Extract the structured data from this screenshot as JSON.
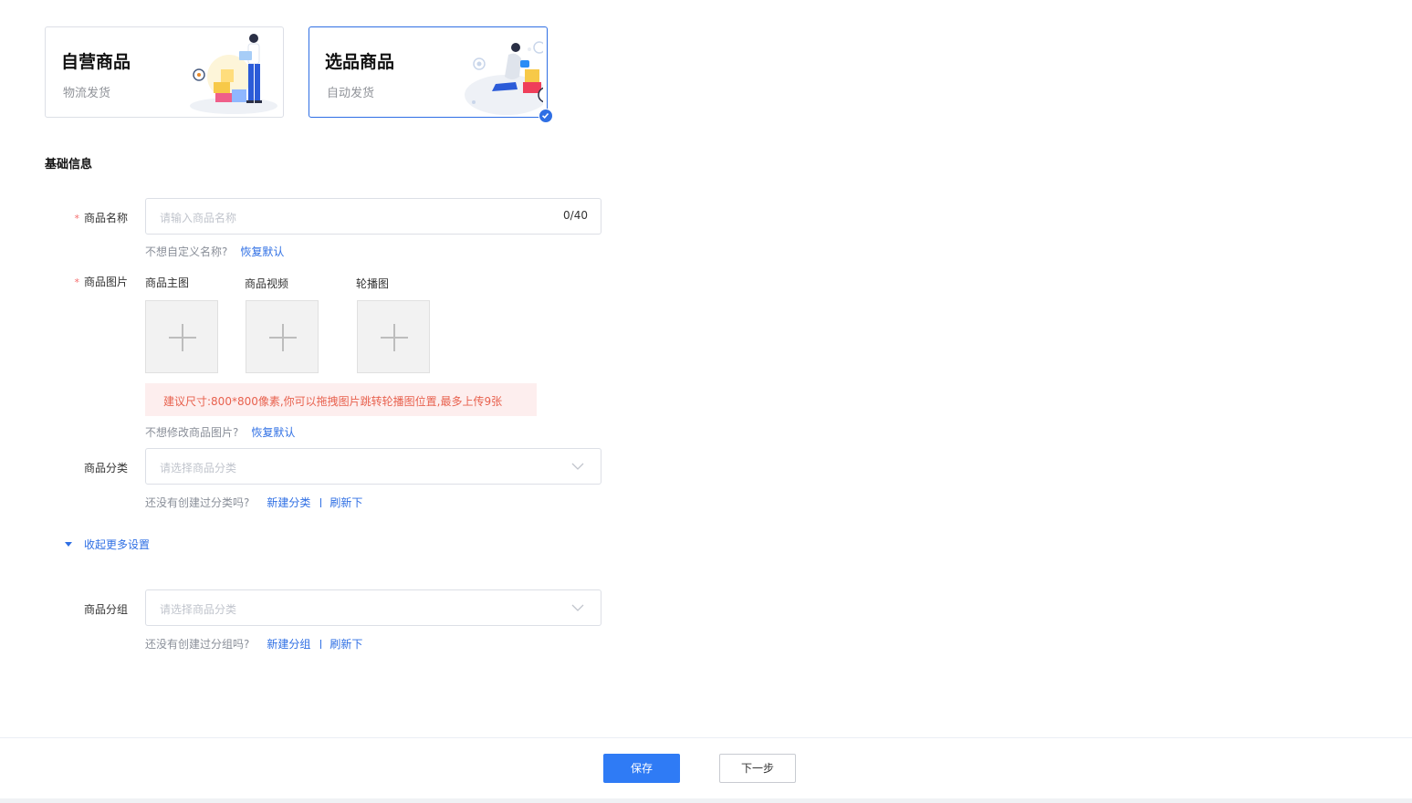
{
  "type_cards": [
    {
      "title": "自营商品",
      "subtitle": "物流发货",
      "selected": false
    },
    {
      "title": "选品商品",
      "subtitle": "自动发货",
      "selected": true
    }
  ],
  "section_title": "基础信息",
  "name_field": {
    "required_mark": "*",
    "label": "商品名称",
    "placeholder": "请输入商品名称",
    "counter": "0/40",
    "hint": "不想自定义名称?",
    "hint_link": "恢复默认"
  },
  "images_field": {
    "required_mark": "*",
    "label": "商品图片",
    "uploads": [
      {
        "label": "商品主图"
      },
      {
        "label": "商品视频"
      },
      {
        "label": "轮播图"
      }
    ],
    "warning": "建议尺寸:800*800像素,你可以拖拽图片跳转轮播图位置,最多上传9张",
    "hint": "不想修改商品图片?",
    "hint_link": "恢复默认"
  },
  "category_field": {
    "label": "商品分类",
    "placeholder": "请选择商品分类",
    "hint": "还没有创建过分类吗?",
    "link_new": "新建分类",
    "link_refresh": "刷新下"
  },
  "collapse_toggle": "收起更多设置",
  "group_field": {
    "label": "商品分组",
    "placeholder": "请选择商品分类",
    "hint": "还没有创建过分组吗?",
    "link_new": "新建分组",
    "link_refresh": "刷新下"
  },
  "footer": {
    "save_label": "保存",
    "next_label": "下一步"
  },
  "colors": {
    "accent": "#2f6fe4",
    "primary_button": "#2f7bf5",
    "warning_bg": "#fdeeee",
    "warning_text": "#e8614e",
    "required": "#f56c6c"
  }
}
